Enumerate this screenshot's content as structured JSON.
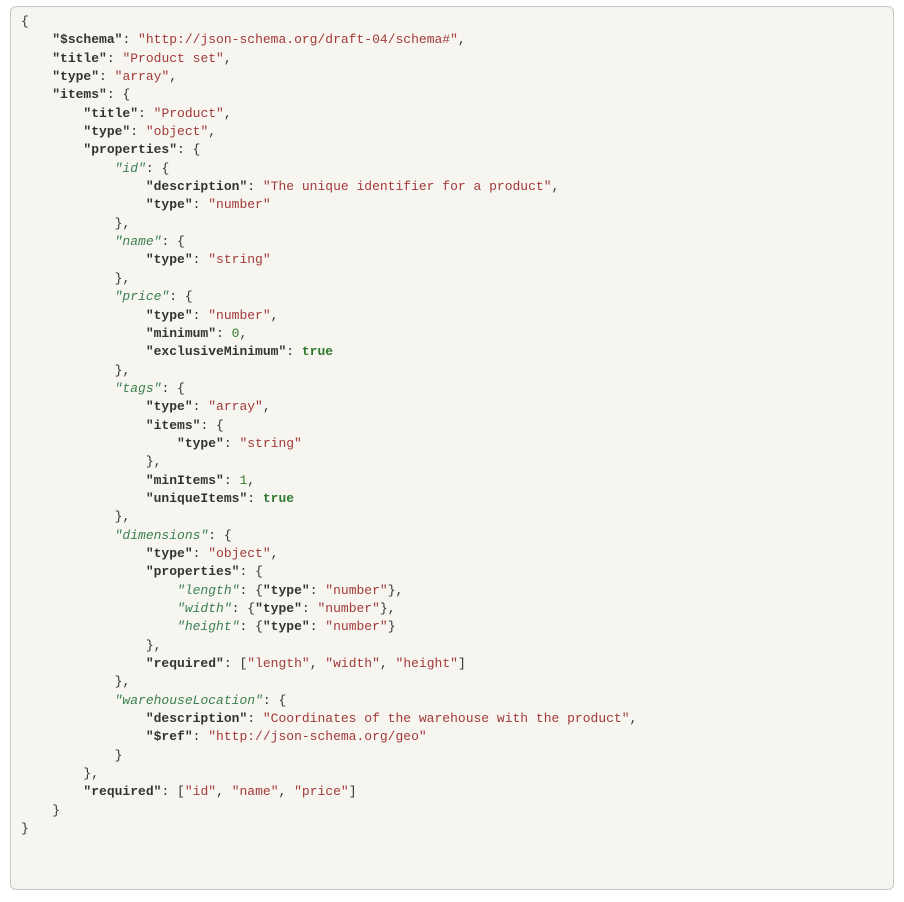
{
  "tokens": {
    "t_ob": "{",
    "t_cb": "}",
    "t_os": "[",
    "t_cs": "]",
    "t_c": ",",
    "t_col": ": ",
    "k_schema": "\"$schema\"",
    "v_schema": "\"http://json-schema.org/draft-04/schema#\"",
    "k_title": "\"title\"",
    "v_title_root": "\"Product set\"",
    "k_type": "\"type\"",
    "v_type_array": "\"array\"",
    "k_items": "\"items\"",
    "v_title_product": "\"Product\"",
    "v_type_object": "\"object\"",
    "k_properties": "\"properties\"",
    "ik_id": "\"id\"",
    "k_description": "\"description\"",
    "v_desc_id": "\"The unique identifier for a product\"",
    "v_type_number": "\"number\"",
    "ik_name": "\"name\"",
    "v_type_string": "\"string\"",
    "ik_price": "\"price\"",
    "k_minimum": "\"minimum\"",
    "v_zero": "0",
    "k_exclmin": "\"exclusiveMinimum\"",
    "v_true": "true",
    "ik_tags": "\"tags\"",
    "k_minItems": "\"minItems\"",
    "v_one": "1",
    "k_uniqueItems": "\"uniqueItems\"",
    "ik_dimensions": "\"dimensions\"",
    "ik_length": "\"length\"",
    "ik_width": "\"width\"",
    "ik_height": "\"height\"",
    "k_required": "\"required\"",
    "v_req_length": "\"length\"",
    "v_req_width": "\"width\"",
    "v_req_height": "\"height\"",
    "ik_whLoc": "\"warehouseLocation\"",
    "v_desc_wh": "\"Coordinates of the warehouse with the product\"",
    "k_ref": "\"$ref\"",
    "v_ref_geo": "\"http://json-schema.org/geo\"",
    "v_req_id": "\"id\"",
    "v_req_name": "\"name\"",
    "v_req_price": "\"price\""
  }
}
